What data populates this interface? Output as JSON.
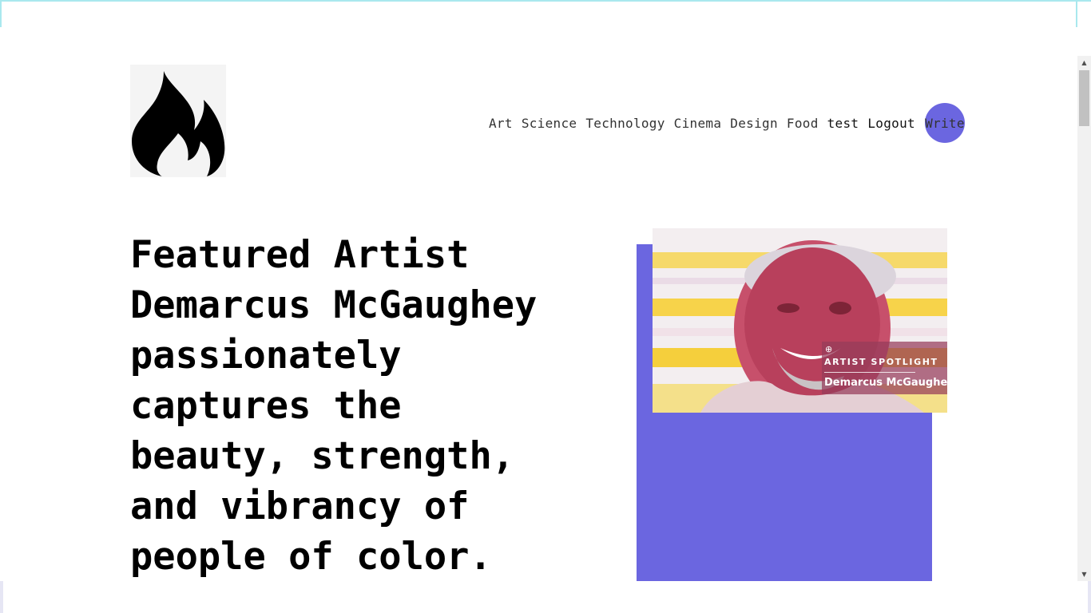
{
  "nav": {
    "items": [
      {
        "label": "Art"
      },
      {
        "label": "Science"
      },
      {
        "label": "Technology"
      },
      {
        "label": "Cinema"
      },
      {
        "label": "Design"
      },
      {
        "label": "Food"
      }
    ],
    "user": "test",
    "logout": "Logout",
    "write": "Write"
  },
  "logo": {
    "icon": "flame-icon"
  },
  "hero": {
    "headline": "Featured Artist Demarcus McGaughey passionately captures the beauty, strength, and vibrancy of people of color.",
    "image": {
      "badge_label": "ARTIST SPOTLIGHT",
      "badge_name": "Demarcus McGaughey",
      "badge_icon": "location-pin-icon"
    }
  },
  "colors": {
    "accent": "#6b66e0",
    "text": "#000000"
  }
}
